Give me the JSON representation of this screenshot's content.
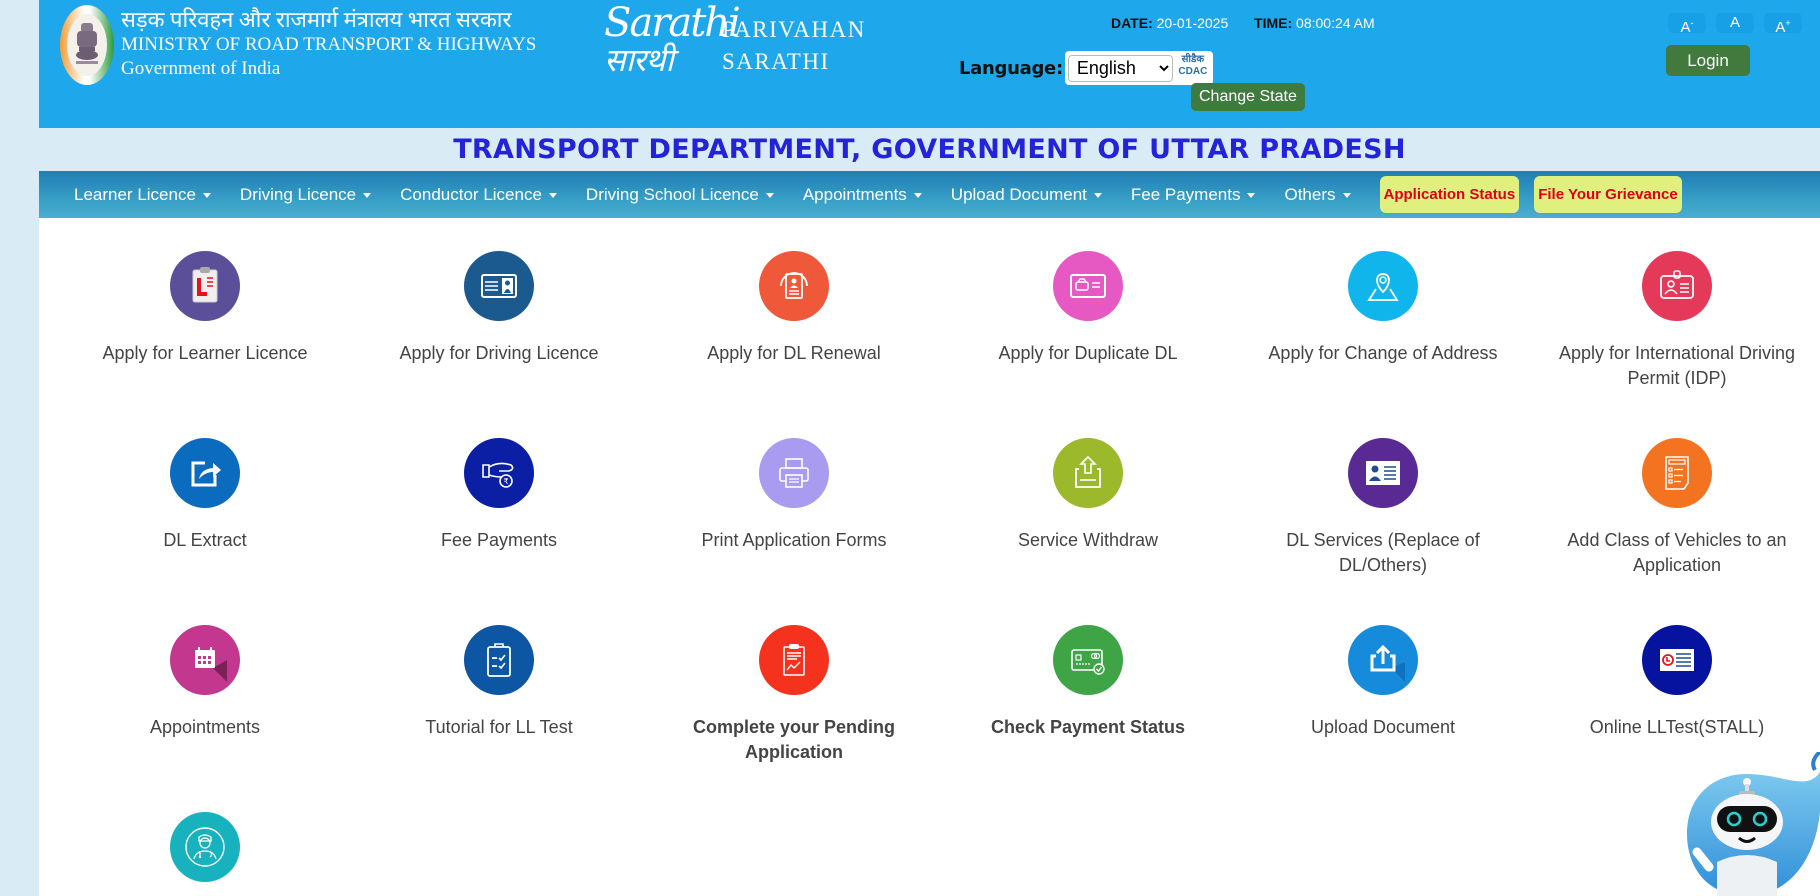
{
  "header": {
    "ministry_hindi": "सड़क परिवहन और राजमार्ग मंत्रालय भारत सरकार",
    "ministry_english": "MINISTRY OF ROAD TRANSPORT & HIGHWAYS",
    "government": "Government of India",
    "logo_line1": "Sarathi",
    "logo_line2": "सारथी",
    "brand_line1": "PARIVAHAN",
    "brand_line2": "SARATHI",
    "date_label": "DATE:",
    "date_value": "20-01-2025",
    "time_label": "TIME:",
    "time_value": "08:00:24 AM",
    "language_label": "Language:",
    "language_selected": "English",
    "cdac_hindi": "सीडैक",
    "cdac_english": "CDAC",
    "change_state_label": "Change State",
    "font_decrease": "A",
    "font_decrease_sup": "-",
    "font_normal": "A",
    "font_increase": "A",
    "font_increase_sup": "+",
    "login_label": "Login"
  },
  "department_title": "TRANSPORT DEPARTMENT, GOVERNMENT OF UTTAR PRADESH",
  "nav": {
    "items": [
      {
        "label": "Learner Licence"
      },
      {
        "label": "Driving Licence"
      },
      {
        "label": "Conductor Licence"
      },
      {
        "label": "Driving School Licence"
      },
      {
        "label": "Appointments"
      },
      {
        "label": "Upload Document"
      },
      {
        "label": "Fee Payments"
      },
      {
        "label": "Others"
      }
    ],
    "application_status": "Application Status",
    "file_grievance": "File Your Grievance"
  },
  "services": [
    {
      "label": "Apply for Learner Licence",
      "icon": "learner-licence-clipboard-icon",
      "color": "#5b4f9a"
    },
    {
      "label": "Apply for Driving Licence",
      "icon": "driving-licence-card-icon",
      "color": "#1a5a8e"
    },
    {
      "label": "Apply for DL Renewal",
      "icon": "renewal-icon",
      "color": "#f0583a"
    },
    {
      "label": "Apply for Duplicate DL",
      "icon": "duplicate-dl-car-card-icon",
      "color": "#e659c2"
    },
    {
      "label": "Apply for Change of Address",
      "icon": "map-location-pin-icon",
      "color": "#10b5ec"
    },
    {
      "label": "Apply for International Driving Permit (IDP)",
      "icon": "id-badge-icon",
      "color": "#e5395a"
    },
    {
      "label": "DL Extract",
      "icon": "share-export-icon",
      "color": "#0b6bbf"
    },
    {
      "label": "Fee Payments",
      "icon": "hand-rupee-icon",
      "color": "#0a1fa3"
    },
    {
      "label": "Print Application Forms",
      "icon": "printer-icon",
      "color": "#a89bf0"
    },
    {
      "label": "Service Withdraw",
      "icon": "withdraw-upload-tray-icon",
      "color": "#9cb92c"
    },
    {
      "label": "DL Services (Replace of DL/Others)",
      "icon": "id-card-person-icon",
      "color": "#5a2a94"
    },
    {
      "label": "Add Class of Vehicles to an Application",
      "icon": "checklist-document-icon",
      "color": "#f47320"
    },
    {
      "label": "Appointments",
      "icon": "calendar-icon",
      "color": "#c4378f"
    },
    {
      "label": "Tutorial for LL Test",
      "icon": "clipboard-checklist-icon",
      "color": "#0d56a3"
    },
    {
      "label": "Complete your Pending Application",
      "icon": "clipboard-report-icon",
      "color": "#f4321e",
      "bold": true
    },
    {
      "label": "Check Payment Status",
      "icon": "card-payment-check-icon",
      "color": "#3ea446",
      "bold": true
    },
    {
      "label": "Upload Document",
      "icon": "upload-icon",
      "color": "#168bdb"
    },
    {
      "label": "Online LLTest(STALL)",
      "icon": "ll-test-card-icon",
      "color": "#06139e"
    },
    {
      "label": "",
      "icon": "doctor-icon",
      "color": "#17b2bd"
    }
  ],
  "chatbot": {
    "icon": "chatbot-robot-icon"
  }
}
